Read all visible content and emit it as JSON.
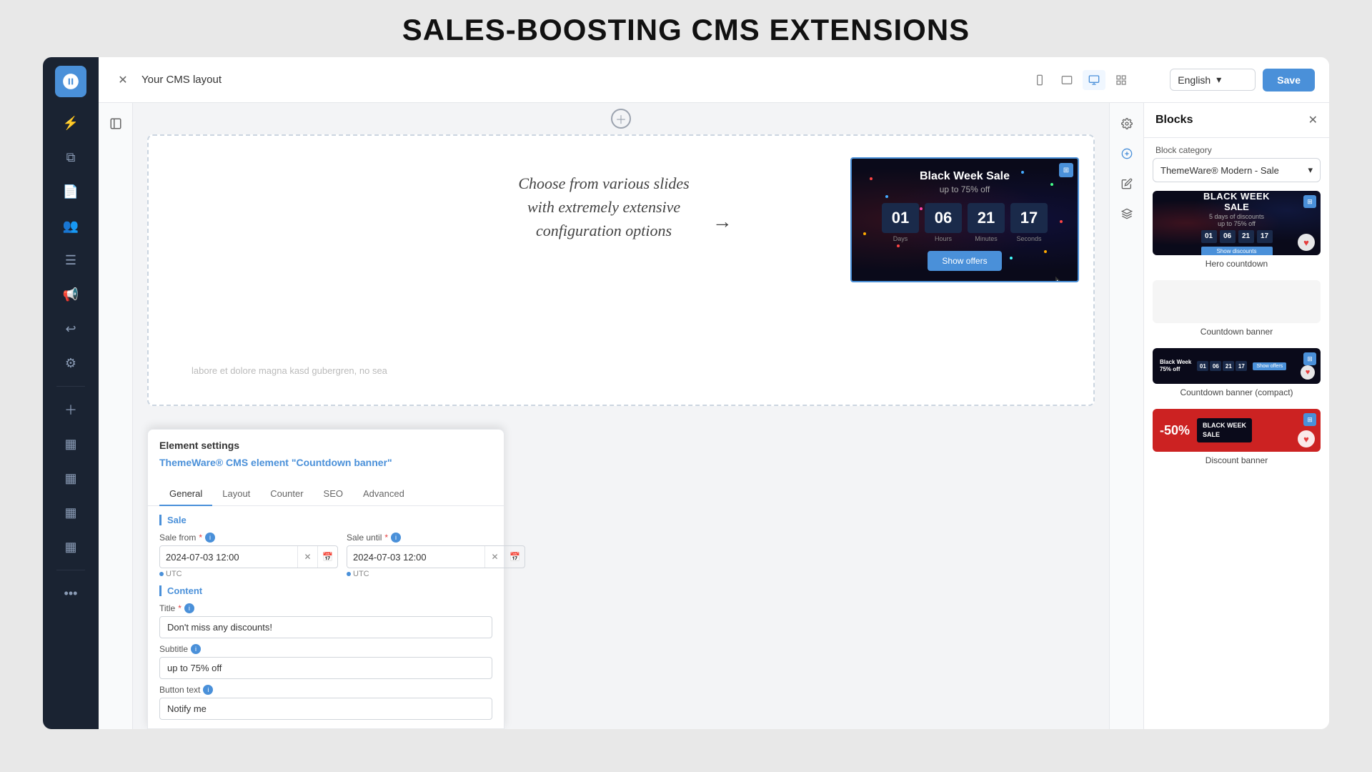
{
  "page": {
    "headline": "SALES-BOOSTING CMS EXTENSIONS"
  },
  "topbar": {
    "title": "Your CMS layout",
    "lang": "English",
    "save_label": "Save"
  },
  "devices": [
    {
      "name": "mobile",
      "icon": "📱"
    },
    {
      "name": "tablet",
      "icon": "💻"
    },
    {
      "name": "desktop",
      "icon": "🖥",
      "active": true
    },
    {
      "name": "list",
      "icon": "☰"
    }
  ],
  "blocks_panel": {
    "title": "Blocks",
    "category_label": "Block category",
    "category_value": "ThemeWare® Modern - Sale",
    "items": [
      {
        "name": "Hero countdown",
        "type": "hero"
      },
      {
        "name": "Countdown banner",
        "type": "countdown"
      },
      {
        "name": "Countdown banner (compact)",
        "type": "compact"
      },
      {
        "name": "Discount banner",
        "type": "discount"
      }
    ]
  },
  "element_settings": {
    "header": "Element settings",
    "plugin_title": "ThemeWare® CMS element \"Countdown banner\"",
    "tabs": [
      "General",
      "Layout",
      "Counter",
      "SEO",
      "Advanced"
    ],
    "active_tab": "General",
    "sale_section": "Sale",
    "sale_from_label": "Sale from",
    "sale_from_required": true,
    "sale_from_value": "2024-07-03 12:00",
    "sale_until_label": "Sale until",
    "sale_until_required": true,
    "sale_until_value": "2024-07-03 12:00",
    "utc_label": "UTC",
    "content_section": "Content",
    "title_label": "Title",
    "title_required": true,
    "title_value": "Don't miss any discounts!",
    "subtitle_label": "Subtitle",
    "subtitle_value": "up to 75% off",
    "button_text_label": "Button text",
    "button_text_value": "Notify me"
  },
  "countdown_preview": {
    "title": "Black Week Sale",
    "subtitle": "up to 75% off",
    "days": "01",
    "hours": "06",
    "minutes": "21",
    "seconds": "17",
    "days_label": "Days",
    "hours_label": "Hours",
    "minutes_label": "Minutes",
    "seconds_label": "Seconds",
    "button_label": "Show offers"
  },
  "canvas": {
    "handwritten_text": "Choose from various slides\nwith extremely extensive\nconfiguration options",
    "body_text": "labore et dolore magna kasd gubergren, no sea"
  },
  "sidebar": {
    "items": [
      "dashboard",
      "layers",
      "pages",
      "users",
      "menu",
      "announcements",
      "returns",
      "settings",
      "plus",
      "grid1",
      "grid2",
      "grid3",
      "grid4",
      "more"
    ]
  },
  "colors": {
    "accent": "#4a90d9",
    "sidebar_bg": "#1a2332",
    "danger": "#e53e3e",
    "discount_red": "#cc2222"
  }
}
